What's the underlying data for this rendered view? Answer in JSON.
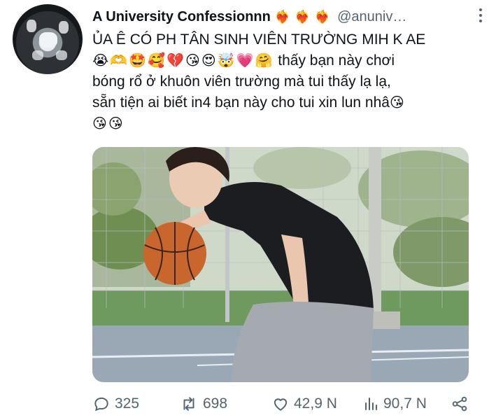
{
  "tweet": {
    "author_name": "A University Confessionnn",
    "name_emojis": [
      "heart-on-fire",
      "heart-on-fire",
      "heart-on-fire"
    ],
    "handle": "@anuniv…",
    "text_line1": "ỦA Ê CÓ PH TÂN SINH VIÊN TRƯỜNG MIH K AE",
    "emojis_line2": [
      "😭",
      "🫶",
      "🤩",
      "🥰",
      "💔",
      "😘",
      "😍",
      "🤯",
      "💗",
      "🤗"
    ],
    "text_line2": "thấy bạn này chơi",
    "text_line3": "bóng rổ ở khuôn viên trường mà tui thấy lạ lạ,",
    "text_line4": "sẵn tiện ai biết in4 bạn này cho tui xin lun nhâ",
    "emoji_line4": "😘",
    "emojis_line5": [
      "😘",
      "😘"
    ]
  },
  "stats": {
    "replies": "325",
    "retweets": "698",
    "likes": "42,9 N",
    "views": "90,7 N"
  },
  "icons": {
    "reply": "reply-icon",
    "retweet": "retweet-icon",
    "like": "like-icon",
    "views": "views-icon",
    "share": "share-icon",
    "more": "more-icon"
  },
  "colors": {
    "text": "#0f1419",
    "secondary": "#536471",
    "heart_fire": "#ff5a2b"
  }
}
